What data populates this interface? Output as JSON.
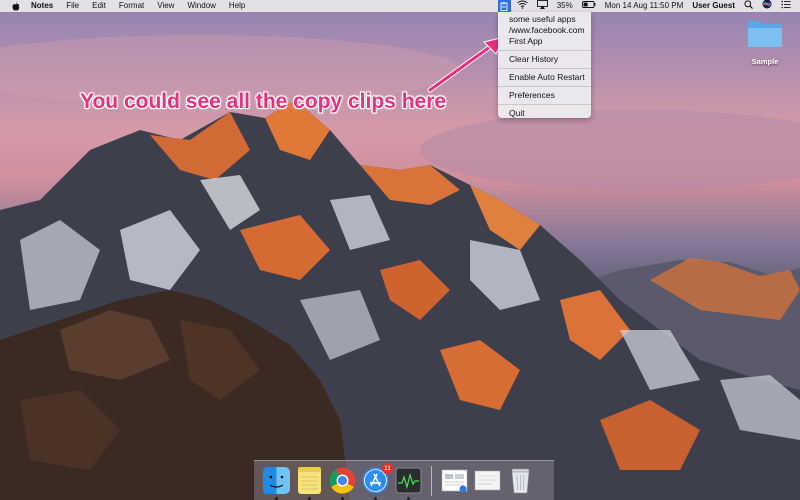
{
  "menubar": {
    "app_name": "Notes",
    "menus": [
      "File",
      "Edit",
      "Format",
      "View",
      "Window",
      "Help"
    ],
    "battery": "35%",
    "datetime": "Mon 14 Aug  11:50 PM",
    "user": "User Guest"
  },
  "dropdown": {
    "clips": [
      "some useful apps",
      "/www.facebook.com",
      "First App"
    ],
    "actions": [
      "Clear History",
      "Enable Auto Restart",
      "Preferences",
      "Quit"
    ]
  },
  "desktop": {
    "folder_label": "Sample"
  },
  "annotation": {
    "text": "You could see all the copy clips here",
    "color": "#e8317a"
  },
  "dock": {
    "app_store_badge": "11"
  },
  "icons": {
    "menubar": [
      "apple-icon",
      "clipboard-icon",
      "wifi-icon",
      "airplay-icon",
      "battery-icon",
      "spotlight-icon",
      "siri-icon",
      "notification-center-icon"
    ],
    "dock": [
      "finder-icon",
      "notes-icon",
      "chrome-icon",
      "app-store-icon",
      "activity-monitor-icon",
      "preview-icon",
      "document-icon",
      "trash-icon"
    ]
  }
}
